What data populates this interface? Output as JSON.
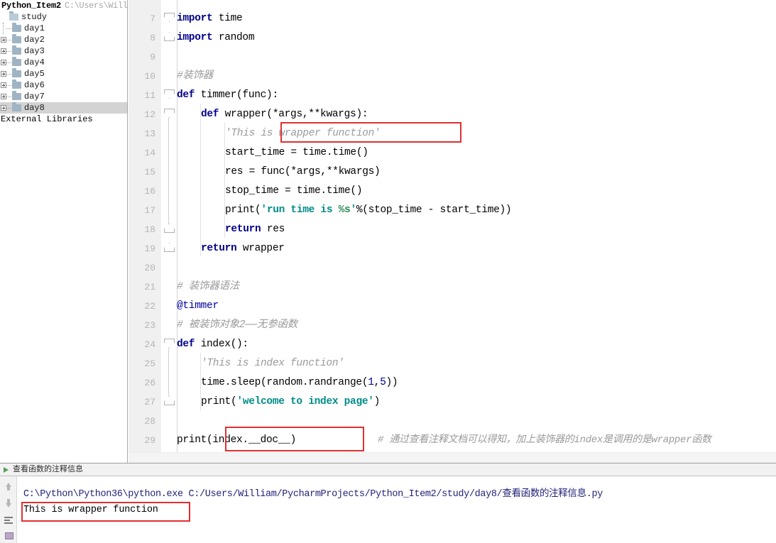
{
  "window": {
    "app": "PyCharm",
    "project_name": "Python_Item2",
    "project_path": "C:\\Users\\Willia"
  },
  "sidebar": {
    "root_label": "study",
    "items": [
      {
        "label": "day1",
        "expandable": false,
        "selected": false
      },
      {
        "label": "day2",
        "expandable": true,
        "selected": false
      },
      {
        "label": "day3",
        "expandable": true,
        "selected": false
      },
      {
        "label": "day4",
        "expandable": true,
        "selected": false
      },
      {
        "label": "day5",
        "expandable": true,
        "selected": false
      },
      {
        "label": "day6",
        "expandable": true,
        "selected": false
      },
      {
        "label": "day7",
        "expandable": true,
        "selected": false
      },
      {
        "label": "day8",
        "expandable": true,
        "selected": true
      }
    ],
    "external_libraries": "External Libraries"
  },
  "editor": {
    "first_line_number": 7,
    "lines": [
      {
        "n": "7",
        "text": "import time"
      },
      {
        "n": "8",
        "text": "import random"
      },
      {
        "n": "9",
        "text": ""
      },
      {
        "n": "10",
        "text": "#装饰器"
      },
      {
        "n": "11",
        "text": "def timmer(func):"
      },
      {
        "n": "12",
        "text": "    def wrapper(*args,**kwargs):"
      },
      {
        "n": "13",
        "text": "        'This is wrapper function'"
      },
      {
        "n": "14",
        "text": "        start_time = time.time()"
      },
      {
        "n": "15",
        "text": "        res = func(*args,**kwargs)"
      },
      {
        "n": "16",
        "text": "        stop_time = time.time()"
      },
      {
        "n": "17",
        "text": "        print('run time is %s'%(stop_time - start_time))"
      },
      {
        "n": "18",
        "text": "        return res"
      },
      {
        "n": "19",
        "text": "    return wrapper"
      },
      {
        "n": "20",
        "text": ""
      },
      {
        "n": "21",
        "text": "# 装饰器语法"
      },
      {
        "n": "22",
        "text": "@timmer"
      },
      {
        "n": "23",
        "text": "# 被装饰对象2——无参函数"
      },
      {
        "n": "24",
        "text": "def index():"
      },
      {
        "n": "25",
        "text": "    'This is index function'"
      },
      {
        "n": "26",
        "text": "    time.sleep(random.randrange(1,5))"
      },
      {
        "n": "27",
        "text": "    print('welcome to index page')"
      },
      {
        "n": "28",
        "text": ""
      },
      {
        "n": "29",
        "text": "print(index.__doc__)    # 通过查看注释文档可以得知，加上装饰器的index是调用的是wrapper函数"
      }
    ],
    "tokens": {
      "kw_import": "import",
      "kw_def": "def",
      "kw_return": "return",
      "mod_time": "time",
      "mod_random": "random",
      "comment_decorator": "#装饰器",
      "fn_timmer": "timmer(func):",
      "fn_wrapper": "wrapper(*args,**kwargs):",
      "doc_wrapper": "'This is wrapper function'",
      "l14": "start_time = time.time()",
      "l15": "res = func(*args,**kwargs)",
      "l16": "stop_time = time.time()",
      "l17_print": "print(",
      "l17_str": "'run time is ",
      "l17_fmt": "%s",
      "l17_strend": "'",
      "l17_rest": "%(stop_time - start_time))",
      "l18_res": "res",
      "l19_wrapper": "wrapper",
      "comment_syntax": "# 装饰器语法",
      "decorator": "@timmer",
      "comment_obj2": "# 被装饰对象2——无参函数",
      "fn_index": "index():",
      "doc_index": "'This is index function'",
      "l26": "time.sleep(random.randrange(",
      "l26_a": "1",
      "l26_comma": ",",
      "l26_b": "5",
      "l26_end": "))",
      "l27_print": "print(",
      "l27_str": "'welcome to index page'",
      "l27_end": ")",
      "l29_print": "print(index.__doc__)",
      "l29_comment": "# 通过查看注释文档可以得知，加上装饰器的index是调用的是wrapper函数"
    }
  },
  "run_panel": {
    "tab_label": "查看函数的注释信息",
    "command": "C:\\Python\\Python36\\python.exe C:/Users/William/PycharmProjects/Python_Item2/study/day8/查看函数的注释信息.py",
    "output": "This is wrapper function",
    "toolbar_icons": [
      "arrow-up-icon",
      "arrow-down-icon",
      "soft-wrap-icon",
      "pin-icon"
    ]
  },
  "annotations": {
    "colors": {
      "highlight_box": "#e03030",
      "underline": "#e8403c",
      "keyword": "#00008b",
      "string": "#008b8b",
      "comment": "#9a9a9a",
      "selection": "#d3d3d3"
    }
  }
}
